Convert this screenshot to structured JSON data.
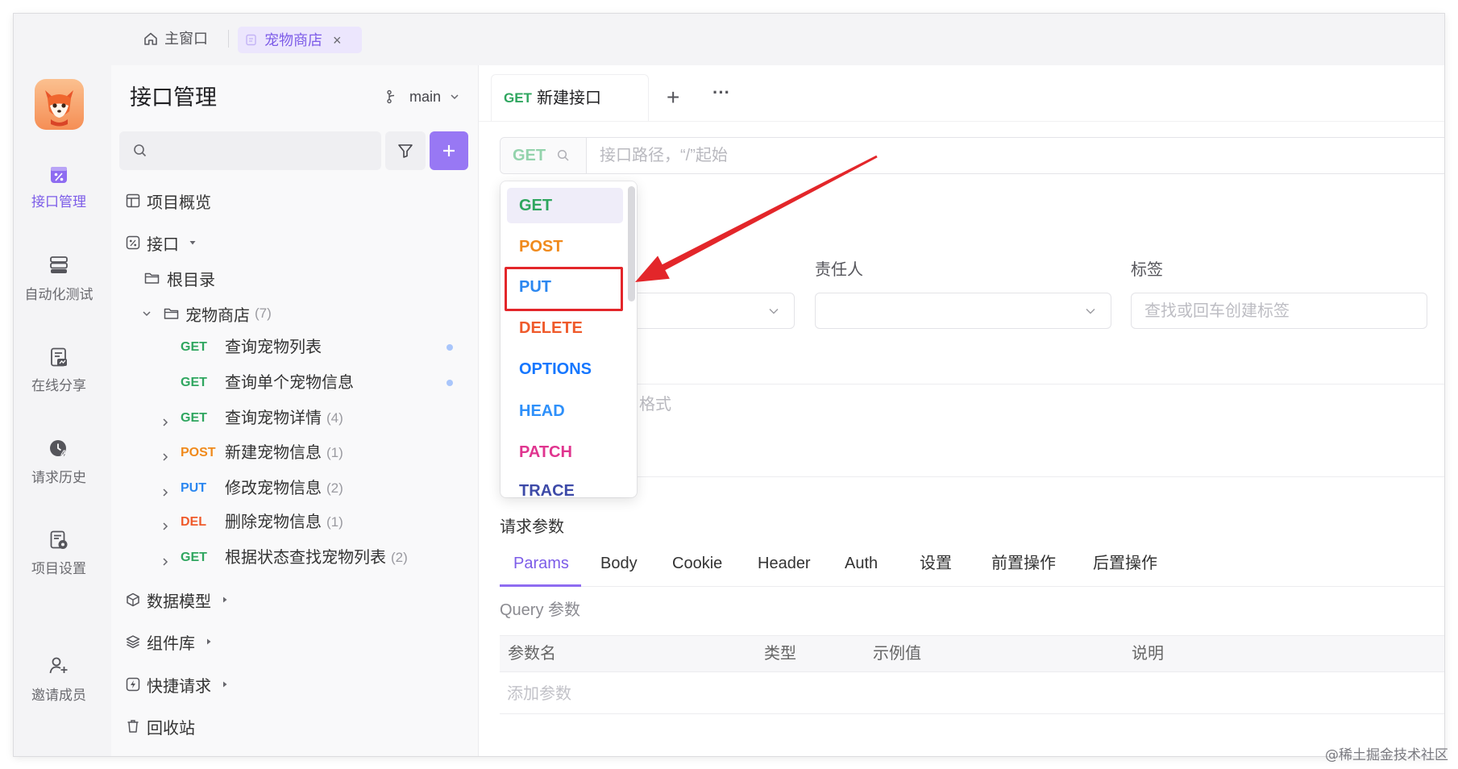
{
  "colors": {
    "accent": "#8e6cf1",
    "accent_light": "#ece6fd",
    "get": "#2fa65f",
    "post": "#f08a1c",
    "put": "#2b87f0",
    "delete": "#ef5a2b",
    "options": "#1677ff",
    "head": "#2e90fa",
    "patch": "#e0358f",
    "trace": "#3d4aa8",
    "annotation": "#e3262a"
  },
  "window_tabs": {
    "home": "主窗口",
    "project": "宠物商店",
    "close": "×"
  },
  "rail": {
    "items": [
      {
        "label": "接口管理",
        "icon": "api-icon",
        "active": true
      },
      {
        "label": "自动化测试",
        "icon": "automation-icon"
      },
      {
        "label": "在线分享",
        "icon": "share-doc-icon"
      },
      {
        "label": "请求历史",
        "icon": "history-icon"
      },
      {
        "label": "项目设置",
        "icon": "project-settings-icon"
      },
      {
        "label": "邀请成员",
        "icon": "invite-member-icon"
      }
    ]
  },
  "sidebar": {
    "title": "接口管理",
    "branch": "main",
    "overview": "项目概览",
    "api_group": "接口",
    "root_folder": "根目录",
    "folder": {
      "name": "宠物商店",
      "count": "(7)"
    },
    "endpoints": [
      {
        "method": "GET",
        "name": "查询宠物列表",
        "count": ""
      },
      {
        "method": "GET",
        "name": "查询单个宠物信息",
        "count": ""
      },
      {
        "method": "GET",
        "name": "查询宠物详情",
        "count": "(4)"
      },
      {
        "method": "POST",
        "name": "新建宠物信息",
        "count": "(1)"
      },
      {
        "method": "PUT",
        "name": "修改宠物信息",
        "count": "(2)"
      },
      {
        "method": "DEL",
        "name": "删除宠物信息",
        "count": "(1)"
      },
      {
        "method": "GET",
        "name": "根据状态查找宠物列表",
        "count": "(2)"
      }
    ],
    "data_model": "数据模型",
    "components": "组件库",
    "quick_request": "快捷请求",
    "trash": "回收站"
  },
  "editor": {
    "tab": {
      "method": "GET",
      "title": "新建接口"
    },
    "new_tab": "+",
    "more": "···",
    "url": {
      "method": "GET",
      "placeholder": "接口路径，“/”起始"
    },
    "method_menu": {
      "selected": "GET",
      "highlighted": "PUT",
      "options": [
        "GET",
        "POST",
        "PUT",
        "DELETE",
        "OPTIONS",
        "HEAD",
        "PATCH",
        "TRACE"
      ]
    },
    "fields": {
      "owner_label": "责任人",
      "tags_label": "标签",
      "tags_placeholder": "查找或回车创建标签"
    },
    "description_partial": "格式",
    "request": {
      "section_title": "请求参数",
      "tabs": [
        "Params",
        "Body",
        "Cookie",
        "Header",
        "Auth",
        "设置",
        "前置操作",
        "后置操作"
      ],
      "active_tab": "Params",
      "query_title": "Query 参数",
      "columns": [
        "参数名",
        "类型",
        "示例值",
        "说明"
      ],
      "add_param": "添加参数"
    }
  },
  "watermark": "@稀土掘金技术社区"
}
